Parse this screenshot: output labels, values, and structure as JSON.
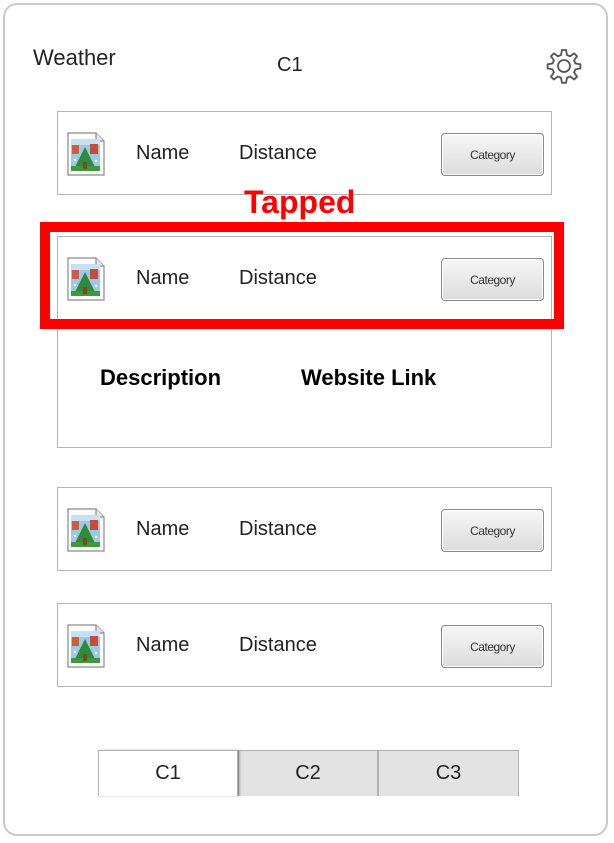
{
  "header": {
    "app_title": "Weather",
    "screen_label": "C1",
    "settings_icon": "gear-icon"
  },
  "list": {
    "items": [
      {
        "name": "Name",
        "distance": "Distance",
        "category_label": "Category",
        "icon": "image-thumbnail-icon"
      },
      {
        "name": "Name",
        "distance": "Distance",
        "category_label": "Category",
        "icon": "image-thumbnail-icon",
        "expanded": true
      },
      {
        "name": "Name",
        "distance": "Distance",
        "category_label": "Category",
        "icon": "image-thumbnail-icon"
      },
      {
        "name": "Name",
        "distance": "Distance",
        "category_label": "Category",
        "icon": "image-thumbnail-icon"
      }
    ],
    "expanded_detail": {
      "description_label": "Description",
      "website_link_label": "Website Link"
    }
  },
  "annotation": {
    "tap_label": "Tapped",
    "color": "#ff0000"
  },
  "tabs": [
    {
      "label": "C1",
      "active": true
    },
    {
      "label": "C2",
      "active": false
    },
    {
      "label": "C3",
      "active": false
    }
  ],
  "colors": {
    "annotation_red": "#ff0000",
    "card_border": "#b5b5b5",
    "inactive_tab": "#e3e3e3"
  }
}
